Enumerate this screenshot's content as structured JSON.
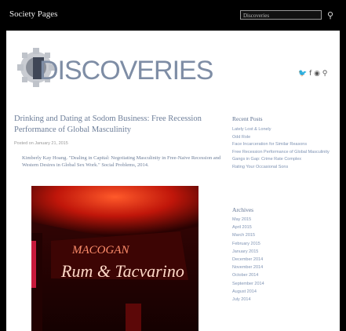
{
  "topbar": {
    "brand": "Society Pages",
    "search_value": "Discoveries",
    "search_icon": "magnifier-icon"
  },
  "logo": {
    "text": "DISCOVERIES"
  },
  "social": {
    "icons": [
      "twitter-icon",
      "facebook-icon",
      "rss-icon",
      "search-icon"
    ],
    "text": "🐦 f ◉ ⚲"
  },
  "post": {
    "title": "Drinking and Dating at Sodom Business: Free Recession Performance of Global Masculinity",
    "meta": "Posted on January 21, 2015",
    "caption": "Kimberly Kay Hoang. \"Dealing in Capital: Negotiating Masculinity in Free-Naive Recession and Western Desires in Global Sex Work.\" Social Problems, 2014."
  },
  "photo": {
    "neon_top": "MACOGAN",
    "neon_main": "Rum & Tacvarino"
  },
  "recent_posts": {
    "heading": "Recent Posts",
    "items": [
      "Lately Lost & Lonely",
      "Odd Role",
      "Face Incarceration for Similar Reasons",
      "Free Recession Performance of Global Masculinity",
      "Gangs in Gap: Crime Rate Complex",
      "Rating Your Occasional Sons"
    ]
  },
  "archives": {
    "heading": "Archives",
    "items": [
      "May 2015",
      "April 2015",
      "March 2015",
      "February 2015",
      "January 2015",
      "December 2014",
      "November 2014",
      "October 2014",
      "September 2014",
      "August 2014",
      "July 2014"
    ]
  }
}
